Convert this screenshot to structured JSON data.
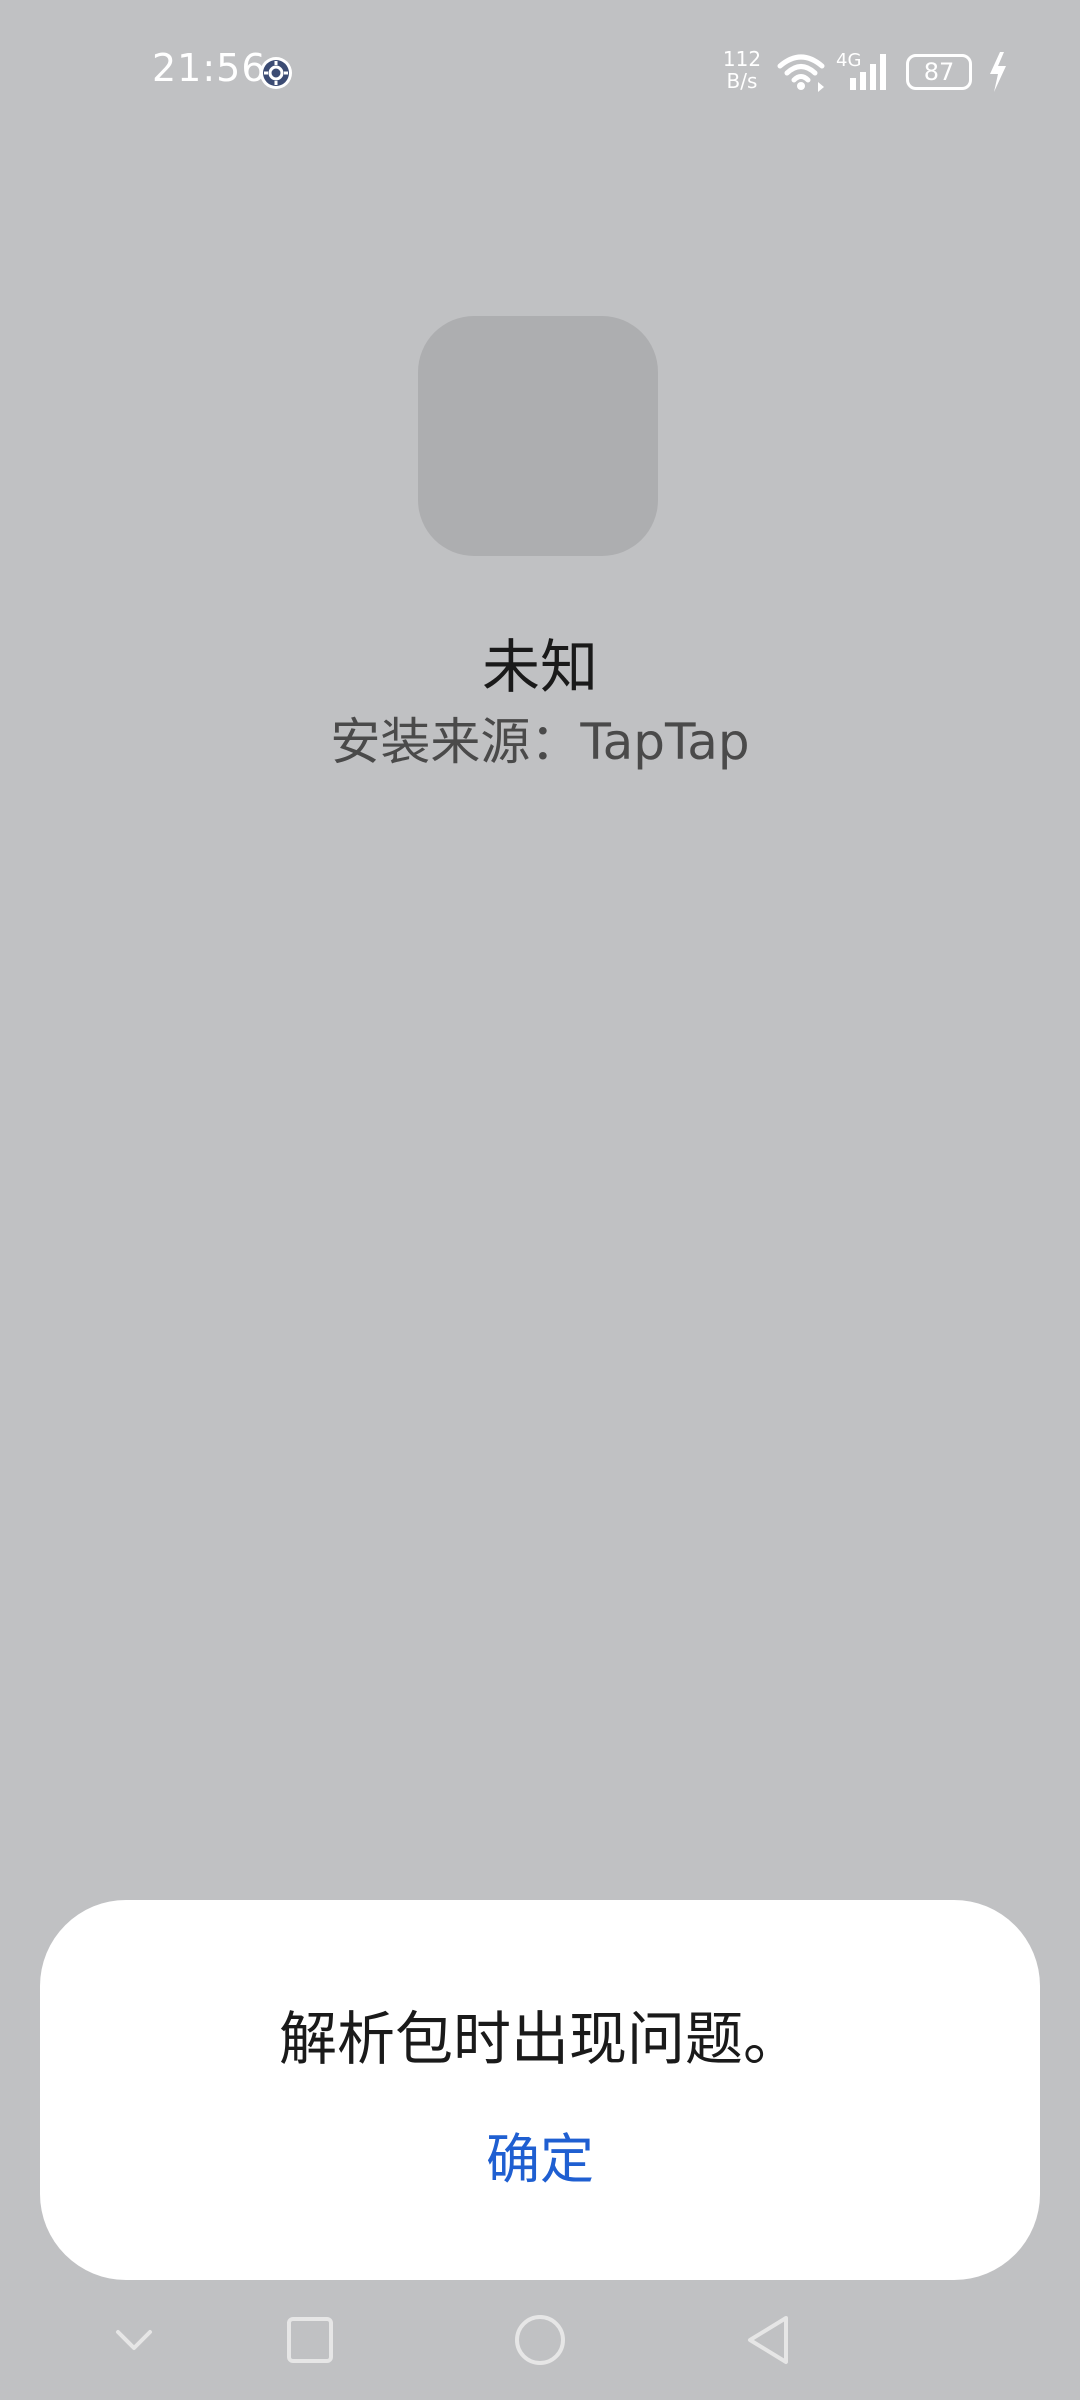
{
  "status_bar": {
    "time": "21:56",
    "net_speed_value": "112",
    "net_speed_unit": "B/s",
    "network_type": "4G",
    "battery_level": "87"
  },
  "app": {
    "name": "未知",
    "install_source": "安装来源：TapTap"
  },
  "dialog": {
    "message": "解析包时出现问题。",
    "ok_label": "确定"
  },
  "icons": {
    "settings": "gear-icon",
    "wifi": "wifi-icon",
    "signal": "signal-icon",
    "charging": "bolt-icon",
    "nav_down": "chevron-down-icon",
    "nav_recent": "square-icon",
    "nav_home": "circle-icon",
    "nav_back": "triangle-back-icon"
  },
  "colors": {
    "background": "#c0c1c3",
    "accent": "#1f5fd1"
  }
}
